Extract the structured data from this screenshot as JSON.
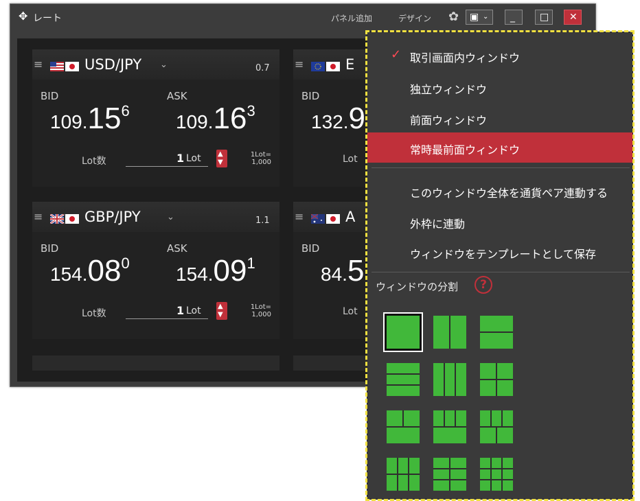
{
  "window": {
    "title": "レート",
    "panel_add": "パネル追加",
    "design": "デザイン",
    "icons": [
      "move-icon",
      "gear-icon",
      "layout-dropdown-icon",
      "minimize-icon",
      "maximize-icon",
      "close-icon"
    ]
  },
  "panels": [
    {
      "pair": "USD/JPY",
      "spread": "0.7",
      "bid_label": "BID",
      "ask_label": "ASK",
      "bid_small": "109.",
      "bid_big": "15",
      "bid_sup": "6",
      "ask_small": "109.",
      "ask_big": "16",
      "ask_sup": "3",
      "lot_label": "Lot数",
      "lot_value": "1",
      "lot_unit": "Lot",
      "lot_note1": "1Lot=",
      "lot_note2": "1,000"
    },
    {
      "pair": "E",
      "bid_label": "BID",
      "bid_small": "132.",
      "bid_big": "9",
      "lot_label": "Lot"
    },
    {
      "pair": "GBP/JPY",
      "spread": "1.1",
      "bid_label": "BID",
      "ask_label": "ASK",
      "bid_small": "154.",
      "bid_big": "08",
      "bid_sup": "0",
      "ask_small": "154.",
      "ask_big": "09",
      "ask_sup": "1",
      "lot_label": "Lot数",
      "lot_value": "1",
      "lot_unit": "Lot",
      "lot_note1": "1Lot=",
      "lot_note2": "1,000"
    },
    {
      "pair": "A",
      "bid_label": "BID",
      "bid_small": "84.",
      "bid_big": "5",
      "lot_label": "Lot"
    }
  ],
  "menu": {
    "items": [
      {
        "label": "取引画面内ウィンドウ",
        "checked": true
      },
      {
        "label": "独立ウィンドウ"
      },
      {
        "label": "前面ウィンドウ"
      },
      {
        "label": "常時最前面ウィンドウ",
        "highlighted": true
      },
      {
        "label": "このウィンドウ全体を通貨ペア連動する"
      },
      {
        "label": "外枠に連動"
      },
      {
        "label": "ウィンドウをテンプレートとして保存"
      }
    ],
    "split_title": "ウィンドウの分割",
    "help_glyph": "?",
    "layout_color": "#41b83a",
    "highlight_color": "#c0303a"
  }
}
